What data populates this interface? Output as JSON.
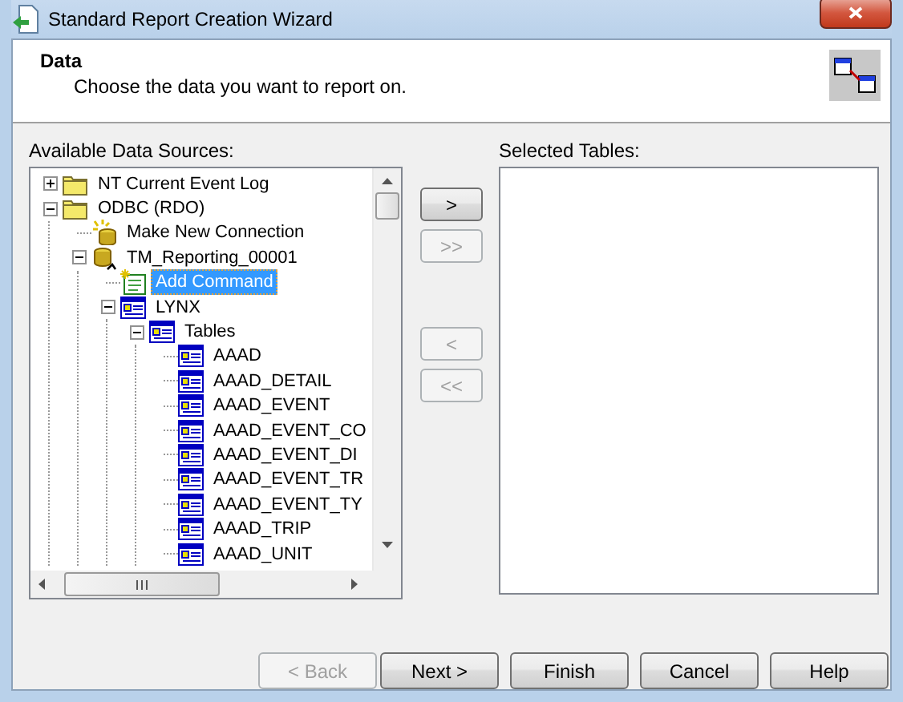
{
  "window": {
    "title": "Standard Report Creation Wizard"
  },
  "header": {
    "title": "Data",
    "subtitle": "Choose the data you want to report on."
  },
  "available": {
    "label": "Available Data Sources:",
    "tree": [
      {
        "kind": "folder",
        "label": "NT Current Event Log",
        "expanded": false,
        "selected": false
      },
      {
        "kind": "folder",
        "label": "ODBC (RDO)",
        "expanded": true,
        "selected": false,
        "children": [
          {
            "kind": "new-connection",
            "label": "Make New Connection",
            "selected": false
          },
          {
            "kind": "database",
            "label": "TM_Reporting_00001",
            "expanded": true,
            "selected": false,
            "children": [
              {
                "kind": "command",
                "label": "Add Command",
                "selected": true
              },
              {
                "kind": "table-group",
                "label": "LYNX",
                "expanded": true,
                "selected": false,
                "children": [
                  {
                    "kind": "table-group",
                    "label": "Tables",
                    "expanded": true,
                    "selected": false,
                    "children": [
                      {
                        "kind": "table",
                        "label": "AAAD",
                        "selected": false
                      },
                      {
                        "kind": "table",
                        "label": "AAAD_DETAIL",
                        "selected": false
                      },
                      {
                        "kind": "table",
                        "label": "AAAD_EVENT",
                        "selected": false
                      },
                      {
                        "kind": "table",
                        "label": "AAAD_EVENT_CO",
                        "selected": false
                      },
                      {
                        "kind": "table",
                        "label": "AAAD_EVENT_DI",
                        "selected": false
                      },
                      {
                        "kind": "table",
                        "label": "AAAD_EVENT_TR",
                        "selected": false
                      },
                      {
                        "kind": "table",
                        "label": "AAAD_EVENT_TY",
                        "selected": false
                      },
                      {
                        "kind": "table",
                        "label": "AAAD_TRIP",
                        "selected": false
                      },
                      {
                        "kind": "table",
                        "label": "AAAD_UNIT",
                        "selected": false
                      }
                    ]
                  }
                ]
              }
            ]
          }
        ]
      }
    ]
  },
  "move_buttons": [
    {
      "label": ">",
      "disabled": false
    },
    {
      "label": ">>",
      "disabled": true
    },
    {
      "label": "<",
      "disabled": true
    },
    {
      "label": "<<",
      "disabled": true
    }
  ],
  "selected": {
    "label": "Selected Tables:"
  },
  "buttons": [
    {
      "label": "< Back",
      "disabled": true
    },
    {
      "label": "Next >",
      "disabled": false
    },
    {
      "label": "Finish",
      "disabled": false
    },
    {
      "label": "Cancel",
      "disabled": false
    },
    {
      "label": "Help",
      "disabled": false
    }
  ]
}
